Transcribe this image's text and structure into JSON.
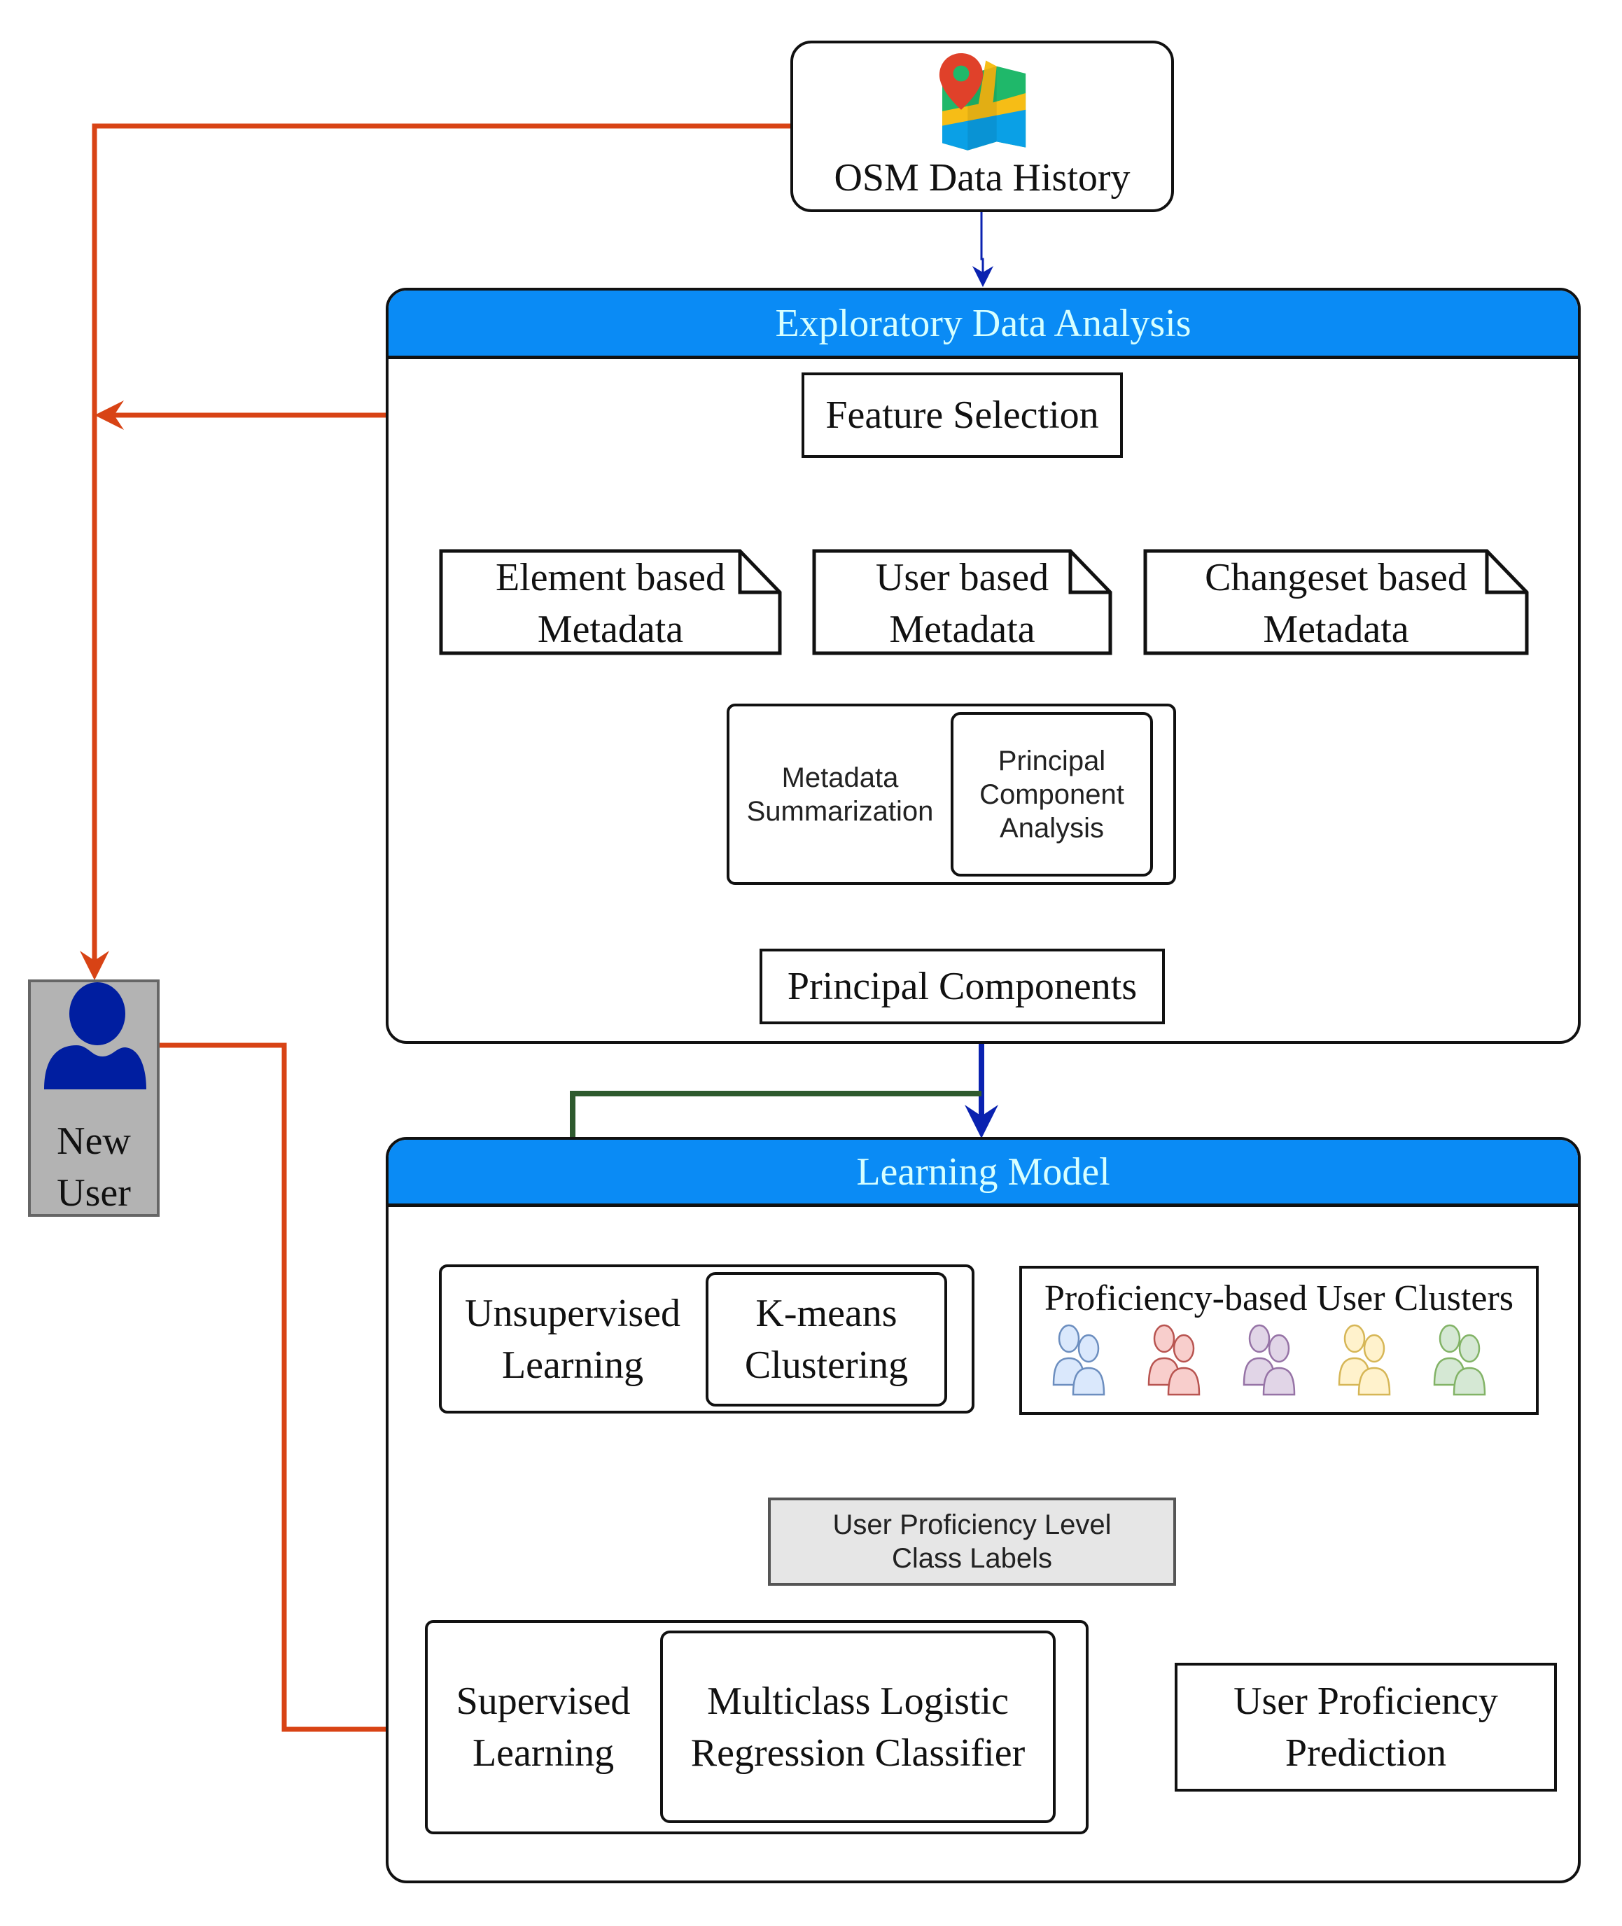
{
  "diagram": {
    "osm_source": {
      "label": "OSM Data History",
      "icon": "map-pin-icon"
    },
    "eda": {
      "title": "Exploratory Data Analysis",
      "feature_selection": "Feature Selection",
      "metadata": [
        {
          "line1": "Element based",
          "line2": "Metadata"
        },
        {
          "line1": "User based",
          "line2": "Metadata"
        },
        {
          "line1": "Changeset based",
          "line2": "Metadata"
        }
      ],
      "summarization": {
        "line1": "Metadata",
        "line2": "Summarization"
      },
      "pca": {
        "line1": "Principal",
        "line2": "Component",
        "line3": "Analysis"
      },
      "principal_components": "Principal Components"
    },
    "new_user": {
      "line1": "New",
      "line2": "User",
      "icon": "user-icon"
    },
    "learning_model": {
      "title": "Learning Model",
      "unsupervised": {
        "line1": "Unsupervised",
        "line2": "Learning"
      },
      "kmeans": {
        "line1": "K-means",
        "line2": "Clustering"
      },
      "clusters": {
        "title": "Proficiency-based User Clusters",
        "groups": [
          {
            "name": "cluster-1",
            "fill": "#dae8fc",
            "stroke": "#6c8ebf"
          },
          {
            "name": "cluster-2",
            "fill": "#f8cecc",
            "stroke": "#b85450"
          },
          {
            "name": "cluster-3",
            "fill": "#e1d5e7",
            "stroke": "#9673a6"
          },
          {
            "name": "cluster-4",
            "fill": "#fff2cc",
            "stroke": "#d6b656"
          },
          {
            "name": "cluster-5",
            "fill": "#d5e8d4",
            "stroke": "#82b366"
          }
        ]
      },
      "class_labels": {
        "line1": "User Proficiency Level",
        "line2": "Class Labels"
      },
      "supervised": {
        "line1": "Supervised",
        "line2": "Learning"
      },
      "mlr": {
        "line1": "Multiclass Logistic",
        "line2": "Regression Classifier"
      },
      "prediction": {
        "line1": "User Proficiency",
        "line2": "Prediction"
      }
    },
    "colors": {
      "header_blue": "#0a8bf5",
      "header_text": "#d6ffff",
      "arrow_blue": "#0a22b0",
      "arrow_green": "#2e5a2e",
      "arrow_orange": "#d84315",
      "user_box": "#b3b3b3",
      "user_icon": "#001ea0",
      "labels_box": "#e6e6e6"
    }
  }
}
